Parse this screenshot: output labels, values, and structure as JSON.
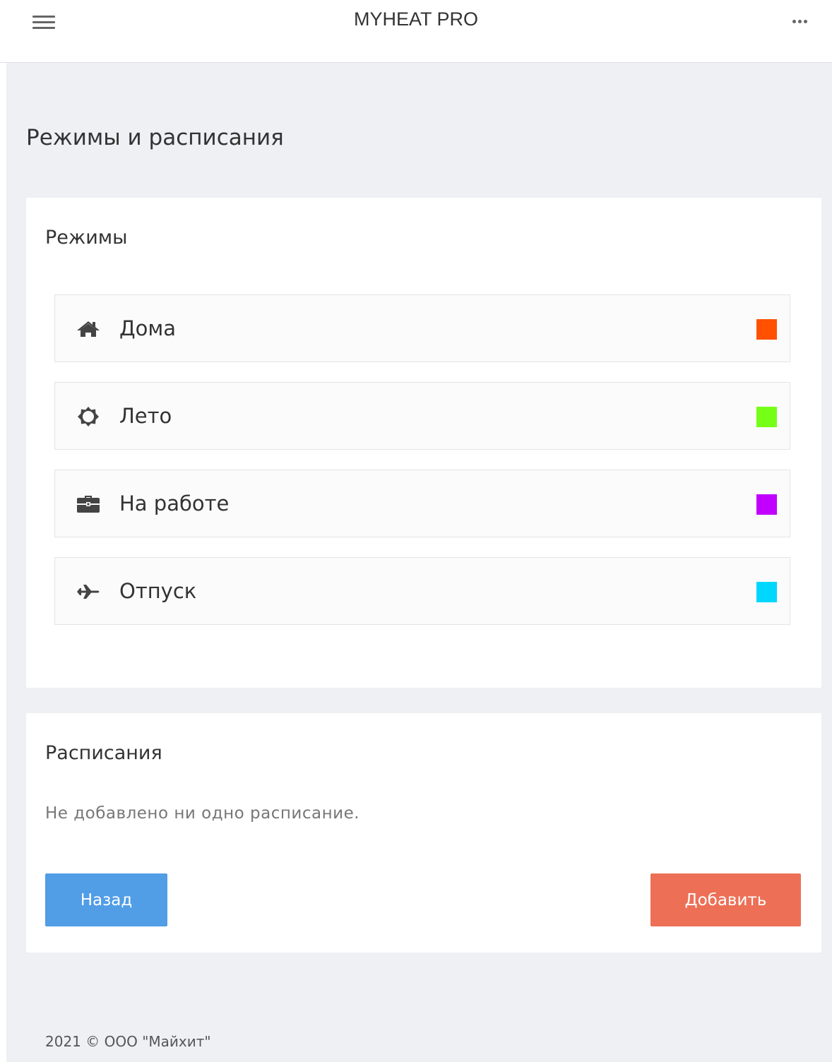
{
  "header": {
    "title": "MYHEAT PRO",
    "menu_icon": "hamburger-menu-icon",
    "more_icon": "more-dots-icon"
  },
  "page": {
    "title": "Режимы и расписания"
  },
  "modes": {
    "title": "Режимы",
    "items": [
      {
        "label": "Дома",
        "icon": "home-icon",
        "color": "#ff5100"
      },
      {
        "label": "Лето",
        "icon": "sun-icon",
        "color": "#76ff16"
      },
      {
        "label": "На работе",
        "icon": "briefcase-icon",
        "color": "#c100ff"
      },
      {
        "label": "Отпуск",
        "icon": "plane-icon",
        "color": "#00d7ff"
      }
    ]
  },
  "schedules": {
    "title": "Расписания",
    "empty_text": "Не добавлено ни одно расписание.",
    "back_label": "Назад",
    "add_label": "Добавить"
  },
  "colors": {
    "back_button": "#519de6",
    "add_button": "#ed7056",
    "background": "#eef0f4"
  },
  "footer": {
    "text": "2021 © ООО \"Майхит\""
  }
}
